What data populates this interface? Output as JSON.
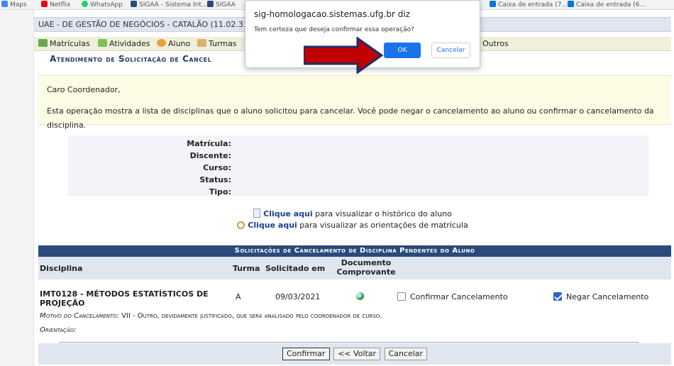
{
  "bookmarks": [
    {
      "label": "Maps",
      "color": "#4285f4"
    },
    {
      "label": "Netflix",
      "color": "#e50914"
    },
    {
      "label": "WhatsApp",
      "color": "#25d366"
    },
    {
      "label": "SIGAA - Sistema Int...",
      "color": "#2b4a7b"
    },
    {
      "label": "SIGAA",
      "color": "#2b4a7b"
    },
    {
      "label": "Caixa de entrada (7...",
      "color": "#0078d4"
    },
    {
      "label": "Caixa de entrada (6...",
      "color": "#0078d4"
    }
  ],
  "unit": {
    "name": "UAE - DE GESTÃO DE NEGÓCIOS - CATALÃO (11.02.31)"
  },
  "menu": {
    "items": [
      {
        "label": "Matrículas"
      },
      {
        "label": "Atividades"
      },
      {
        "label": "Aluno"
      },
      {
        "label": "Turmas"
      },
      {
        "label": "Outros"
      }
    ]
  },
  "page_title": "Atendimento de Solicitação de Cancel",
  "notice": {
    "greeting": "Caro Coordenador,",
    "text": "Esta operação mostra a lista de disciplinas que o aluno solicitou para cancelar. Você pode negar o cancelamento ao aluno ou confirmar o cancelamento da disciplina."
  },
  "student_info": {
    "labels": [
      "Matrícula:",
      "Discente:",
      "Curso:",
      "Status:",
      "Tipo:"
    ]
  },
  "links": {
    "history_link": "Clique aqui",
    "history_text": " para visualizar o histórico do aluno",
    "guidance_link": "Clique aqui",
    "guidance_text": " para visualizar as orientações de matrícula"
  },
  "table": {
    "title": "Solicitações de Cancelamento de Disciplina Pendentes do Aluno",
    "headers": {
      "disciplina": "Disciplina",
      "turma": "Turma",
      "solicitado": "Solicitado em",
      "documento_line1": "Documento",
      "documento_line2": "Comprovante"
    },
    "row": {
      "disciplina_line1": "IMT0128 - MÉTODOS ESTATÍSTICOS DE",
      "disciplina_line2": "PROJEÇÃO",
      "turma": "A",
      "solicitado": "09/03/2021",
      "confirm_label": "Confirmar Cancelamento",
      "confirm_checked": false,
      "deny_label": "Negar Cancelamento",
      "deny_checked": true,
      "motivo_label": "Motivo do Cancelamento:",
      "motivo_text": " VII - Outro, devidamente justificado, que será analisado pelo coordenador de curso.",
      "orientacao_label": "Orientação:"
    }
  },
  "footer": {
    "confirm": "Confirmar",
    "back": "<< Voltar",
    "cancel": "Cancelar"
  },
  "dialog": {
    "title": "sig-homologacao.sistemas.ufg.br diz",
    "message": "Tem certeza que deseja confirmar essa operação?",
    "ok": "OK",
    "cancel": "Cancelar"
  },
  "colors": {
    "header_blue": "#2b4a7b",
    "accent_blue": "#1a73e8",
    "arrow_red": "#c00000"
  }
}
